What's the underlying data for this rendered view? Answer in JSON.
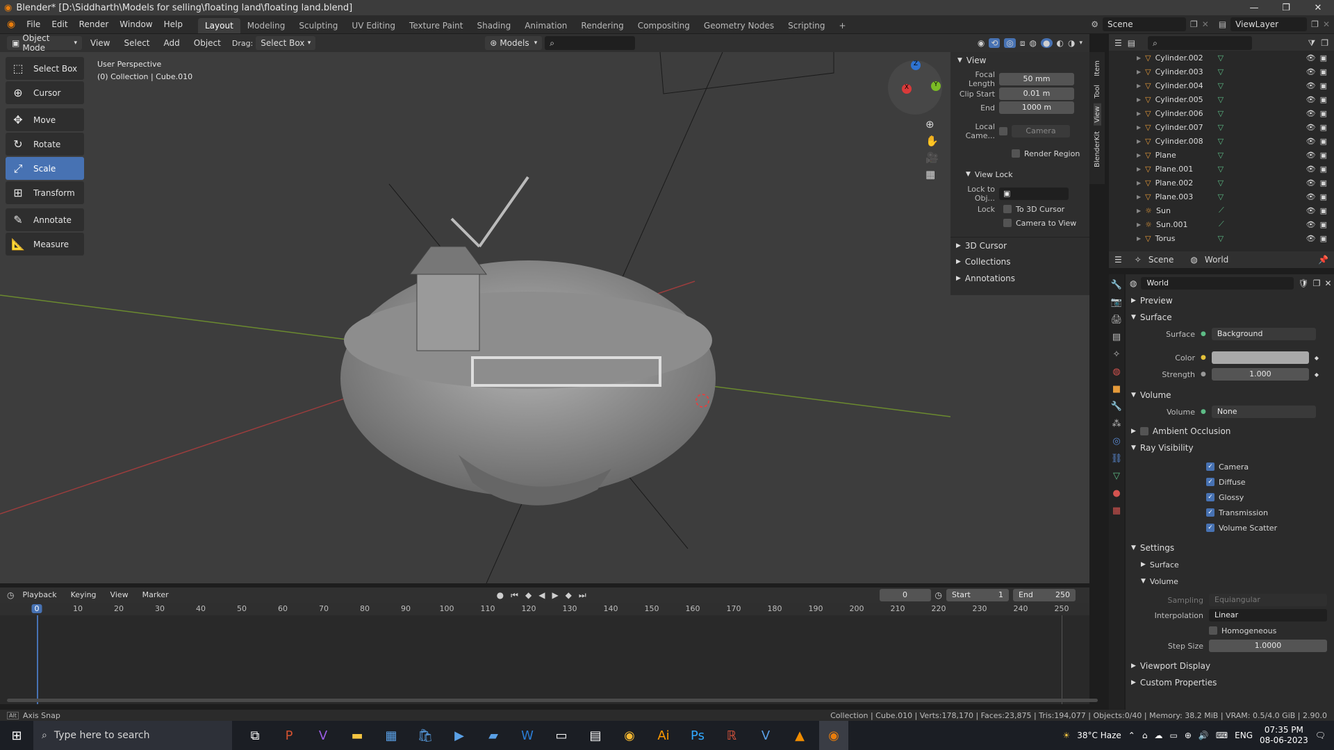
{
  "titlebar": {
    "title": "Blender* [D:\\Siddharth\\Models for selling\\floating land\\floating land.blend]",
    "minimize": "—",
    "maximize": "❐",
    "close": "✕"
  },
  "menubar": {
    "menus": [
      "File",
      "Edit",
      "Render",
      "Window",
      "Help"
    ],
    "workspaces": [
      "Layout",
      "Modeling",
      "Sculpting",
      "UV Editing",
      "Texture Paint",
      "Shading",
      "Animation",
      "Rendering",
      "Compositing",
      "Geometry Nodes",
      "Scripting"
    ],
    "add_tab": "+",
    "scene_label": "Scene",
    "viewlayer_label": "ViewLayer"
  },
  "header3d": {
    "mode": "Object Mode",
    "menus": [
      "View",
      "Select",
      "Add",
      "Object"
    ],
    "drag_label": "Drag:",
    "drag_value": "Select Box",
    "models": "Models"
  },
  "viewport": {
    "info_line1": "User Perspective",
    "info_line2": "(0) Collection | Cube.010"
  },
  "toolbar": {
    "tools": [
      {
        "label": "Select Box",
        "icon": "⬚",
        "active": false
      },
      {
        "label": "Cursor",
        "icon": "⊕",
        "active": false
      },
      {
        "label": "Move",
        "icon": "✥",
        "active": false
      },
      {
        "label": "Rotate",
        "icon": "↻",
        "active": false
      },
      {
        "label": "Scale",
        "icon": "⤢",
        "active": true
      },
      {
        "label": "Transform",
        "icon": "⊞",
        "active": false
      },
      {
        "label": "Annotate",
        "icon": "✎",
        "active": false
      },
      {
        "label": "Measure",
        "icon": "📐",
        "active": false
      }
    ]
  },
  "npanel": {
    "section_view": "View",
    "focal_label": "Focal Length",
    "focal_value": "50 mm",
    "clip_start_label": "Clip Start",
    "clip_start_value": "0.01 m",
    "end_label": "End",
    "end_value": "1000 m",
    "local_camera_label": "Local Came...",
    "camera_value": "Camera",
    "render_region": "Render Region",
    "view_lock": "View Lock",
    "lock_obj_label": "Lock to Obj...",
    "lock_label": "Lock",
    "to_cursor": "To 3D Cursor",
    "camera_to_view": "Camera to View",
    "cursor": "3D Cursor",
    "collections": "Collections",
    "annotations": "Annotations",
    "tabs": [
      "Item",
      "Tool",
      "View",
      "BlenderKit"
    ]
  },
  "outliner": {
    "items": [
      {
        "name": "Cylinder.002",
        "type": "mesh"
      },
      {
        "name": "Cylinder.003",
        "type": "mesh"
      },
      {
        "name": "Cylinder.004",
        "type": "mesh"
      },
      {
        "name": "Cylinder.005",
        "type": "mesh"
      },
      {
        "name": "Cylinder.006",
        "type": "mesh"
      },
      {
        "name": "Cylinder.007",
        "type": "mesh"
      },
      {
        "name": "Cylinder.008",
        "type": "mesh"
      },
      {
        "name": "Plane",
        "type": "mesh"
      },
      {
        "name": "Plane.001",
        "type": "mesh"
      },
      {
        "name": "Plane.002",
        "type": "mesh"
      },
      {
        "name": "Plane.003",
        "type": "mesh"
      },
      {
        "name": "Sun",
        "type": "light"
      },
      {
        "name": "Sun.001",
        "type": "light"
      },
      {
        "name": "Torus",
        "type": "mesh"
      }
    ]
  },
  "properties": {
    "scene_tab": "Scene",
    "world_tab": "World",
    "world_name": "World",
    "preview": "Preview",
    "surface": "Surface",
    "surface_label": "Surface",
    "surface_value": "Background",
    "color_label": "Color",
    "strength_label": "Strength",
    "strength_value": "1.000",
    "volume": "Volume",
    "volume_label": "Volume",
    "volume_value": "None",
    "ambient_occlusion": "Ambient Occlusion",
    "ray_visibility": "Ray Visibility",
    "ray_items": [
      "Camera",
      "Diffuse",
      "Glossy",
      "Transmission",
      "Volume Scatter"
    ],
    "settings": "Settings",
    "settings_surface": "Surface",
    "settings_volume": "Volume",
    "sampling_label": "Sampling",
    "sampling_value": "Equiangular",
    "interpolation_label": "Interpolation",
    "interpolation_value": "Linear",
    "homogeneous": "Homogeneous",
    "step_size_label": "Step Size",
    "step_size_value": "1.0000",
    "viewport_display": "Viewport Display",
    "custom_properties": "Custom Properties",
    "color_swatch": "#a9a9a9"
  },
  "timeline": {
    "menus": [
      "Playback",
      "Keying",
      "View",
      "Marker"
    ],
    "current_frame": "0",
    "start_label": "Start",
    "start_value": "1",
    "end_label": "End",
    "end_value": "250",
    "ticks": [
      "0",
      "10",
      "20",
      "30",
      "40",
      "50",
      "60",
      "70",
      "80",
      "90",
      "100",
      "110",
      "120",
      "130",
      "140",
      "150",
      "160",
      "170",
      "180",
      "190",
      "200",
      "210",
      "220",
      "230",
      "240",
      "250"
    ]
  },
  "statusbar": {
    "left": "Axis Snap",
    "right": "Collection | Cube.010 | Verts:178,170 | Faces:23,875 | Tris:194,077 | Objects:0/40 | Memory: 38.2 MiB | VRAM: 0.5/4.0 GiB | 2.90.0"
  },
  "taskbar": {
    "search_placeholder": "Type here to search",
    "weather": "38°C  Haze",
    "lang": "ENG",
    "time": "07:35 PM",
    "date": "08-06-2023"
  },
  "colors": {
    "accent": "#4772b3",
    "mesh_icon": "#e59a3a",
    "mesh_data": "#5dbc86"
  }
}
